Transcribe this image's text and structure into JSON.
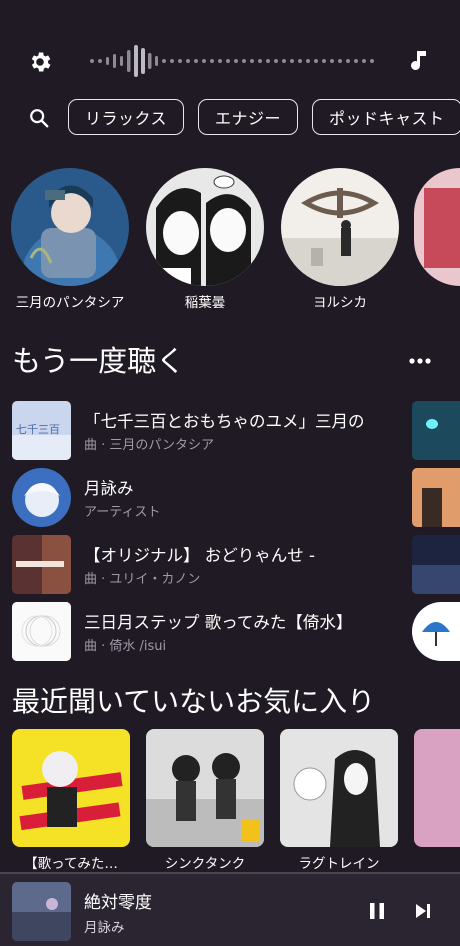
{
  "header": {
    "settings_icon": "gear-icon",
    "waveform_icon": "waveform-icon",
    "music_icon": "music-note-icon"
  },
  "search_icon": "search-icon",
  "chips": [
    "リラックス",
    "エナジー",
    "ポッドキャスト"
  ],
  "artists": [
    {
      "name": "三月のパンタシア"
    },
    {
      "name": "稲葉曇"
    },
    {
      "name": "ヨルシカ"
    }
  ],
  "listen_again": {
    "title": "もう一度聴く",
    "more_icon": "more-horizontal-icon",
    "items": [
      {
        "title": "「七千三百とおもちゃのユメ」三月の",
        "sub": "曲 · 三月のパンタシア"
      },
      {
        "title": "月詠み",
        "sub": "アーティスト"
      },
      {
        "title": "【オリジナル】 おどりゃんせ -",
        "sub": "曲 · ユリイ・カノン"
      },
      {
        "title": "三日月ステップ 歌ってみた【倚水】",
        "sub": "曲 · 倚水 /isui"
      }
    ]
  },
  "favorites": {
    "title": "最近聞いていないお気に入り",
    "cards": [
      {
        "caption": "【歌ってみた…"
      },
      {
        "caption": "シンクタンク"
      },
      {
        "caption": "ラグトレイン"
      }
    ]
  },
  "now_playing": {
    "title": "絶対零度",
    "artist": "月詠み",
    "pause_icon": "pause-icon",
    "next_icon": "skip-next-icon"
  }
}
